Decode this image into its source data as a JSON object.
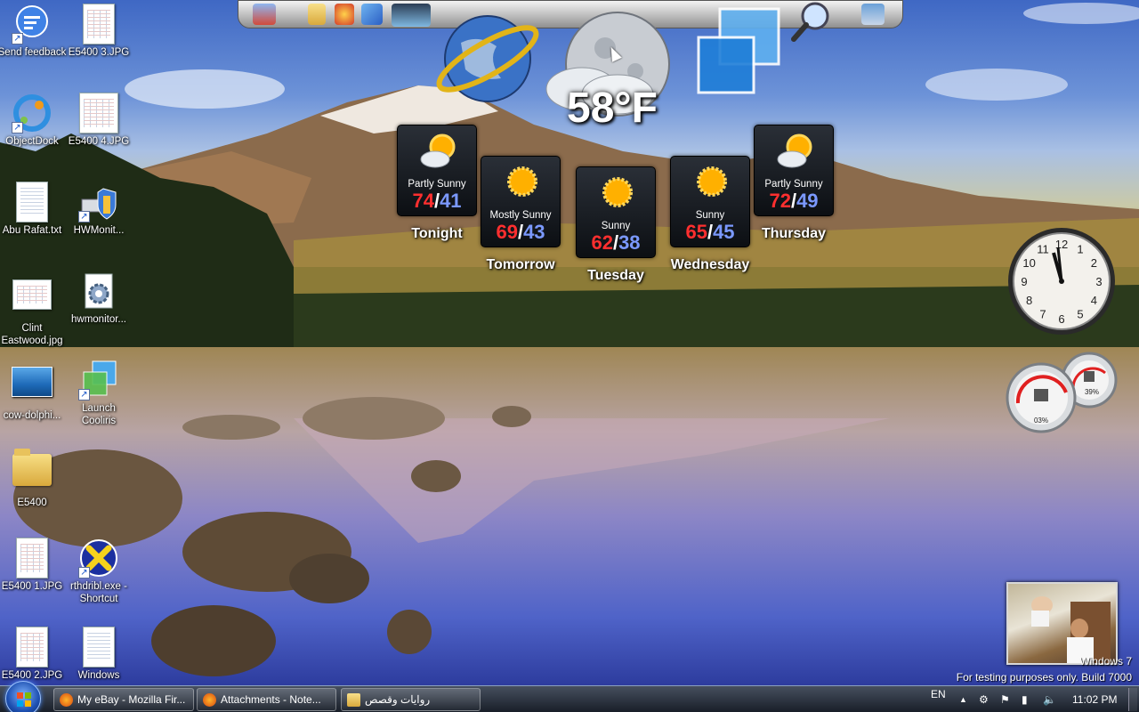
{
  "desktop": {
    "icons": [
      {
        "label": "Send feedback",
        "kind": "feedback"
      },
      {
        "label": "E5400 3.JPG",
        "kind": "sheet"
      },
      {
        "label": "ObjectDock",
        "kind": "objectdock"
      },
      {
        "label": "E5400 4.JPG",
        "kind": "sheet"
      },
      {
        "label": "Abu Rafat.txt",
        "kind": "doc"
      },
      {
        "label": "HWMonit...",
        "kind": "hwmonitor"
      },
      {
        "label": "Clint Eastwood.jpg",
        "kind": "sheet"
      },
      {
        "label": "hwmonitor...",
        "kind": "gear"
      },
      {
        "label": "cow-dolphi...",
        "kind": "photo"
      },
      {
        "label": "Launch Cooliris",
        "kind": "cooliris"
      },
      {
        "label": "E5400",
        "kind": "folder"
      },
      {
        "label": "E5400 1.JPG",
        "kind": "sheet"
      },
      {
        "label": "rthdribl.exe - Shortcut",
        "kind": "xapp"
      },
      {
        "label": "E5400 2.JPG",
        "kind": "sheet"
      },
      {
        "label": "Windows",
        "kind": "doc"
      }
    ]
  },
  "weather": {
    "current_temp": "58°F",
    "forecast": [
      {
        "day": "Tonight",
        "condition": "Partly Sunny",
        "high": "74",
        "low": "41",
        "icon": "partly-sunny-icon"
      },
      {
        "day": "Tomorrow",
        "condition": "Mostly Sunny",
        "high": "69",
        "low": "43",
        "icon": "sun-icon"
      },
      {
        "day": "Tuesday",
        "condition": "Sunny",
        "high": "62",
        "low": "38",
        "icon": "sun-icon"
      },
      {
        "day": "Wednesday",
        "condition": "Sunny",
        "high": "65",
        "low": "45",
        "icon": "sun-icon"
      },
      {
        "day": "Thursday",
        "condition": "Partly Sunny",
        "high": "72",
        "low": "49",
        "icon": "partly-sunny-icon"
      }
    ],
    "separator": "/"
  },
  "clock": {
    "numbers": [
      "12",
      "1",
      "2",
      "3",
      "4",
      "5",
      "6",
      "7",
      "8",
      "9",
      "10",
      "11"
    ]
  },
  "meters": {
    "cpu": "03%",
    "memory": "39%"
  },
  "watermark": {
    "line1": "Windows 7",
    "line2": "For testing purposes only. Build 7000"
  },
  "taskbar": {
    "buttons": [
      {
        "label": "My eBay - Mozilla Fir..."
      },
      {
        "label": "Attachments - Note..."
      },
      {
        "label": "روايات وقصص"
      }
    ],
    "language": "EN",
    "time": "11:02 PM",
    "colors": {
      "accent": "#1d4fb0"
    }
  }
}
